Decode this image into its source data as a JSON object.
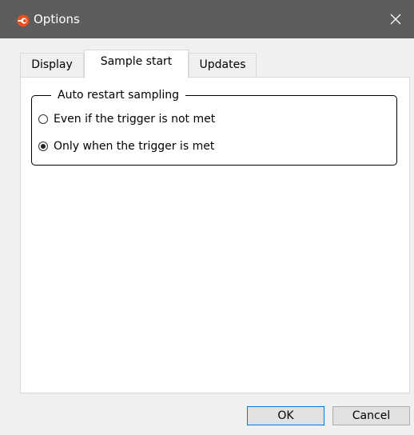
{
  "window": {
    "title": "Options",
    "icon": "app-logo-icon",
    "close_icon": "close-icon"
  },
  "tabs": [
    {
      "label": "Display",
      "active": false
    },
    {
      "label": "Sample start",
      "active": true
    },
    {
      "label": "Updates",
      "active": false
    }
  ],
  "group": {
    "label": "Auto restart sampling",
    "options": [
      {
        "label": "Even if the trigger is not met",
        "checked": false
      },
      {
        "label": "Only when the trigger is met",
        "checked": true
      }
    ]
  },
  "buttons": {
    "ok_label": "OK",
    "cancel_label": "Cancel"
  },
  "colors": {
    "titlebar": "#5d5d5d",
    "icon_accent": "#e8501e",
    "default_button_border": "#0078d7"
  }
}
